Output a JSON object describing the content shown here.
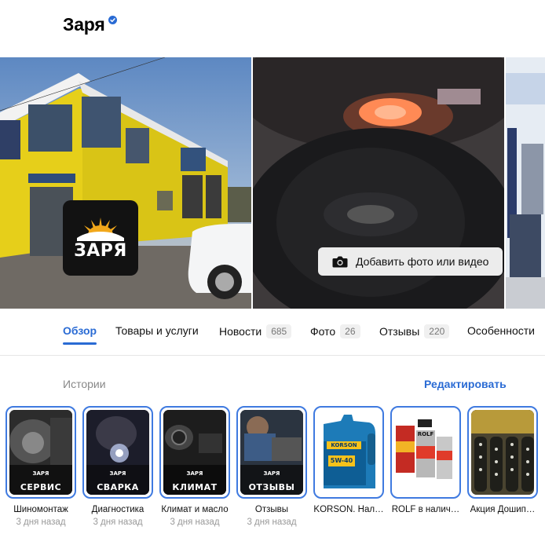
{
  "header": {
    "title": "Заря",
    "verified_icon": "verified-check-icon"
  },
  "gallery": {
    "logo_text": "ЗАРЯ",
    "add_photo_label": "Добавить фото или видео",
    "add_photo_icon": "camera-icon"
  },
  "tabs": [
    {
      "label": "Обзор",
      "count": null,
      "active": true
    },
    {
      "label": "Товары и услуги",
      "count": null,
      "active": false
    },
    {
      "label": "Новости",
      "count": "685",
      "active": false
    },
    {
      "label": "Фото",
      "count": "26",
      "active": false
    },
    {
      "label": "Отзывы",
      "count": "220",
      "active": false
    },
    {
      "label": "Особенности",
      "count": null,
      "active": false
    }
  ],
  "stories": {
    "label": "Истории",
    "edit_label": "Редактировать",
    "items": [
      {
        "name": "Шиномонтаж",
        "time": "3 дня назад",
        "logo": "ЗАРЯ",
        "caption": "СЕРВИС"
      },
      {
        "name": "Диагностика",
        "time": "3 дня назад",
        "logo": "ЗАРЯ",
        "caption": "СВАРКА"
      },
      {
        "name": "Климат и масло",
        "time": "3 дня назад",
        "logo": "ЗАРЯ",
        "caption": "КЛИМАТ"
      },
      {
        "name": "Отзывы",
        "time": "3 дня назад",
        "logo": "ЗАРЯ",
        "caption": "ОТЗЫВЫ"
      },
      {
        "name": "KORSON. Нал…",
        "time": "",
        "product_label": "KORSON",
        "product_spec": "5W-40"
      },
      {
        "name": "ROLF в налич…",
        "time": "",
        "product_label": "ROLF"
      },
      {
        "name": "Акция Дошип…",
        "time": ""
      }
    ]
  },
  "colors": {
    "accent": "#2a6bd4",
    "story_ring": "#3f7ae0",
    "building_yellow": "#e8d21e"
  }
}
